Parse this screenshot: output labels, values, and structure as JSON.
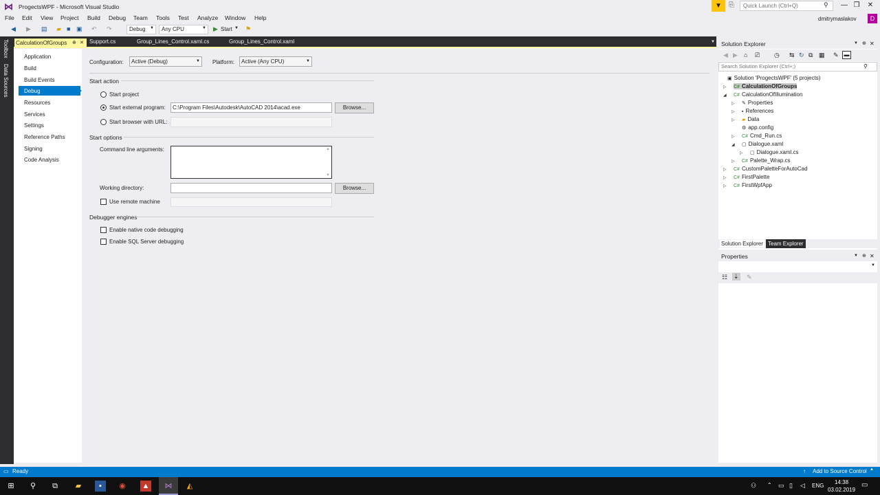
{
  "window": {
    "title": "ProgectsWPF - Microsoft Visual Studio"
  },
  "quick_launch": {
    "placeholder": "Quick Launch (Ctrl+Q)"
  },
  "user": {
    "name": "dmitrymaslakov",
    "initial": "D"
  },
  "menu": [
    "File",
    "Edit",
    "View",
    "Project",
    "Build",
    "Debug",
    "Team",
    "Tools",
    "Test",
    "Analyze",
    "Window",
    "Help"
  ],
  "toolbar": {
    "config": "Debug",
    "platform": "Any CPU",
    "start": "Start"
  },
  "side_tabs": [
    "Toolbox",
    "Data Sources"
  ],
  "doc_tabs": {
    "active": "CalculationOfGroups",
    "others": [
      "Support.cs",
      "Group_Lines_Control.xaml.cs",
      "Group_Lines_Control.xaml"
    ]
  },
  "nav": {
    "items": [
      "Application",
      "Build",
      "Build Events",
      "Debug",
      "Resources",
      "Services",
      "Settings",
      "Reference Paths",
      "Signing",
      "Code Analysis"
    ],
    "selected": "Debug"
  },
  "debug": {
    "configuration_label": "Configuration:",
    "configuration_value": "Active (Debug)",
    "platform_label": "Platform:",
    "platform_value": "Active (Any CPU)",
    "start_action_title": "Start action",
    "start_project": "Start project",
    "start_external": "Start external program:",
    "external_path": "C:\\Program Files\\Autodesk\\AutoCAD 2014\\acad.exe",
    "browse": "Browse...",
    "start_browser": "Start browser with URL:",
    "start_options_title": "Start options",
    "cmd_args": "Command line arguments:",
    "working_dir": "Working directory:",
    "remote": "Use remote machine",
    "engines_title": "Debugger engines",
    "native": "Enable native code debugging",
    "sql": "Enable SQL Server debugging"
  },
  "solution_explorer": {
    "title": "Solution Explorer",
    "search_placeholder": "Search Solution Explorer (Ctrl+;)",
    "solution": "Solution 'ProgectsWPF' (5 projects)",
    "items": {
      "p1": "CalculationOfGroups",
      "p2": "CalculationOfIllumination",
      "properties": "Properties",
      "references": "References",
      "data": "Data",
      "appconfig": "app.config",
      "cmdrun": "Cmd_Run.cs",
      "dialogue": "Dialogue.xaml",
      "dialoguecs": "Dialogue.xaml.cs",
      "palette": "Palette_Wrap.cs",
      "p3": "CustomPaletteForAutoCad",
      "p4": "FirstPalette",
      "p5": "FirstWpfApp"
    },
    "tabs": [
      "Solution Explorer",
      "Team Explorer"
    ]
  },
  "properties_panel": {
    "title": "Properties"
  },
  "status": {
    "text": "Ready",
    "right": "Add to Source Control"
  },
  "taskbar": {
    "lang": "ENG",
    "time": "14:38",
    "date": "03.02.2019"
  }
}
